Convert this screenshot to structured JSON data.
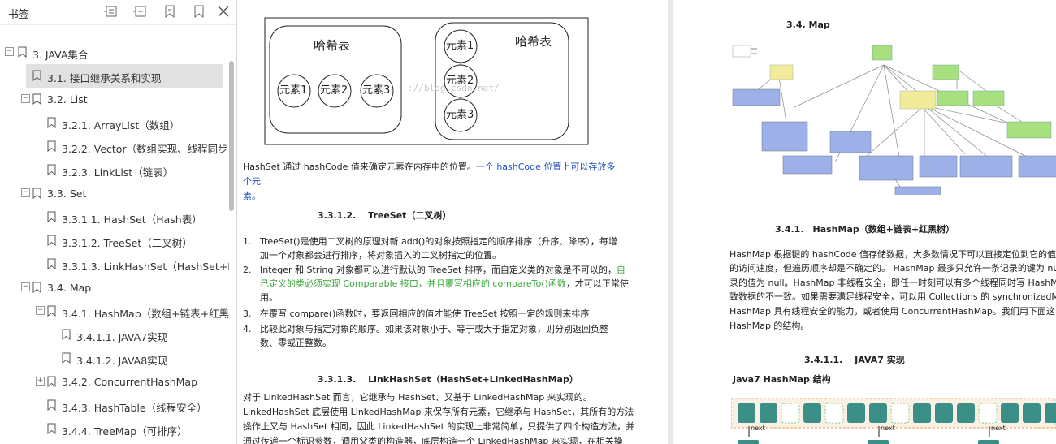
{
  "sidebar": {
    "title": "书签",
    "items": [
      {
        "label": "3. JAVA集合",
        "level": 0,
        "toggle": "−"
      },
      {
        "label": "3.1. 接口继承关系和实现",
        "level": 1,
        "toggle": "",
        "selected": true
      },
      {
        "label": "3.2. List",
        "level": 1,
        "toggle": "−"
      },
      {
        "label": "3.2.1. ArrayList（数组）",
        "level": 2,
        "toggle": ""
      },
      {
        "label": "3.2.2. Vector（数组实现、线程同步",
        "level": 2,
        "toggle": ""
      },
      {
        "label": "3.2.3. LinkList（链表）",
        "level": 2,
        "toggle": ""
      },
      {
        "label": "3.3. Set",
        "level": 1,
        "toggle": "−"
      },
      {
        "label": "3.3.1.1. HashSet（Hash表）",
        "level": 2,
        "toggle": ""
      },
      {
        "label": "3.3.1.2. TreeSet（二叉树）",
        "level": 2,
        "toggle": ""
      },
      {
        "label": "3.3.1.3. LinkHashSet（HashSet+L",
        "level": 2,
        "toggle": ""
      },
      {
        "label": "3.4. Map",
        "level": 1,
        "toggle": "−"
      },
      {
        "label": "3.4.1. HashMap（数组+链表+红黑",
        "level": 2,
        "toggle": "−"
      },
      {
        "label": "3.4.1.1. JAVA7实现",
        "level": 3,
        "toggle": ""
      },
      {
        "label": "3.4.1.2. JAVA8实现",
        "level": 3,
        "toggle": ""
      },
      {
        "label": "3.4.2. ConcurrentHashMap",
        "level": 2,
        "toggle": "+"
      },
      {
        "label": "3.4.3. HashTable（线程安全）",
        "level": 2,
        "toggle": ""
      },
      {
        "label": "3.4.4. TreeMap（可排序）",
        "level": 2,
        "toggle": ""
      }
    ]
  },
  "page1": {
    "diagram": {
      "left_title": "哈希表",
      "right_title": "哈希表",
      "left_elements": [
        "元素1",
        "元素2",
        "元素3"
      ],
      "right_elements": [
        "元素1",
        "元素2",
        "元素3"
      ],
      "watermark": "://blog.csdn.net/"
    },
    "hashset_text": "HashSet 通过 hashCode 值来确定元素在内存中的位置。",
    "hashset_text_blue_1": "一个 hashCode 位置上可以存放多个元",
    "hashset_text_blue_2": "素。",
    "treeset_heading": "3.3.1.2.　 TreeSet（二叉树）",
    "list": [
      {
        "num": "1.",
        "l1": "TreeSet()是使用二叉树的原理对新 add()的对象按照指定的顺序排序（升序、降序），每增",
        "l2": "加一个对象都会进行排序，将对象插入的二叉树指定的位置。"
      },
      {
        "num": "2.",
        "l1a": "Integer 和 String 对象都可以进行默认的 TreeSet 排序，而自定义类的对象是不可以的，",
        "l1g": "自",
        "l2g": "己定义的类必须实现 Comparable 接口，并且覆写相应的 compareTo()函数",
        "l2": "，才可以正常使",
        "l3": "用。"
      },
      {
        "num": "3.",
        "l1": "在覆写 compare()函数时，要返回相应的值才能使 TreeSet 按照一定的规则来排序"
      },
      {
        "num": "4.",
        "l1": "比较此对象与指定对象的顺序。如果该对象小于、等于或大于指定对象，则分别返回负整",
        "l2": "数、零或正整数。"
      }
    ],
    "linkhashset_heading": "3.3.1.3.　 LinkHashSet（HashSet+LinkedHashMap）",
    "linkhashset_lines": [
      " 对于 LinkedHashSet 而言，它继承与 HashSet、又基于 LinkedHashMap 来实现的。",
      "LinkedHashSet 底层使用 LinkedHashMap 来保存所有元素，它继承与 HashSet，其所有的方法",
      "操作上又与 HashSet 相同，因此 LinkedHashSet 的实现上非常简单，只提供了四个构造方法，并",
      "通过传递一个标识参数，调用父类的构造器，底层构造一个 LinkedHashMap 来实现，在相关操"
    ]
  },
  "page2": {
    "map_heading": "3.4. Map",
    "hashmap_heading": "3.4.1.　HashMap（数组+链表+红黑树）",
    "hashmap_lines": [
      "HashMap 根据键的 hashCode 值存储数据，大多数情况下可以直接定位到它的值，因而",
      "的访问速度，但遍历顺序却是不确定的。 HashMap 最多只允许一条记录的键为 null，允",
      "录的值为 null。HashMap 非线程安全，即任一时刻可以有多个线程同时写 HashMap，",
      "致数据的不一致。如果需要满足线程安全，可以用 Collections 的 synchronizedMap",
      "HashMap 具有线程安全的能力，或者使用 ConcurrentHashMap。我们用下面这张",
      "HashMap 的结构。"
    ],
    "java7_heading": "3.4.1.1.　 JAVA7 实现",
    "java7_sub": "Java7 HashMap 结构",
    "next_labels": [
      "next",
      "next",
      "next"
    ]
  }
}
